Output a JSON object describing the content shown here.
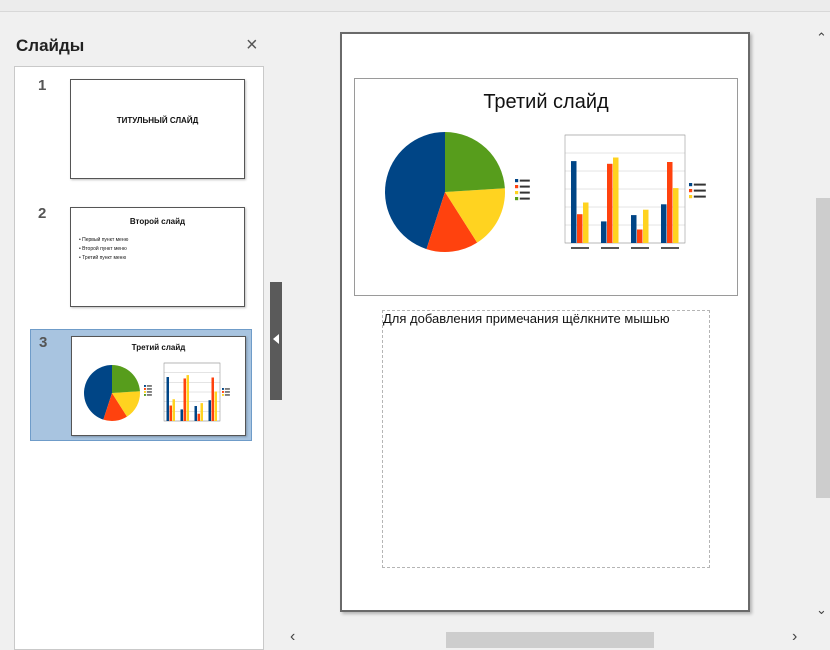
{
  "panel": {
    "title": "Слайды",
    "close_glyph": "×"
  },
  "slides": [
    {
      "number": "1",
      "title": "ТИТУЛЬНЫЙ СЛАЙД"
    },
    {
      "number": "2",
      "title": "Второй слайд",
      "bullets": [
        "Первый пункт меню",
        "Второй пункт меню",
        "Третий пункт меню"
      ]
    },
    {
      "number": "3",
      "title": "Третий слайд",
      "selected": true
    }
  ],
  "current_slide": {
    "title": "Третий слайд",
    "notes_placeholder": "Для добавления примечания щёлкните мышью"
  },
  "colors": {
    "series": [
      "#004586",
      "#ff420e",
      "#ffd320",
      "#579d1c"
    ],
    "selection": "#a8c4e0"
  },
  "scroll": {
    "up": "⌃",
    "down": "⌄",
    "left": "‹",
    "right": "›"
  },
  "chart_data": [
    {
      "type": "pie",
      "values": [
        45,
        14,
        17,
        24
      ]
    },
    {
      "type": "bar",
      "ylim": [
        0,
        12
      ],
      "series": [
        {
          "values": [
            9.1,
            2.4,
            3.1,
            4.3
          ]
        },
        {
          "values": [
            3.2,
            8.8,
            1.5,
            9.0
          ]
        },
        {
          "values": [
            4.5,
            9.5,
            3.7,
            6.1
          ]
        }
      ]
    }
  ]
}
